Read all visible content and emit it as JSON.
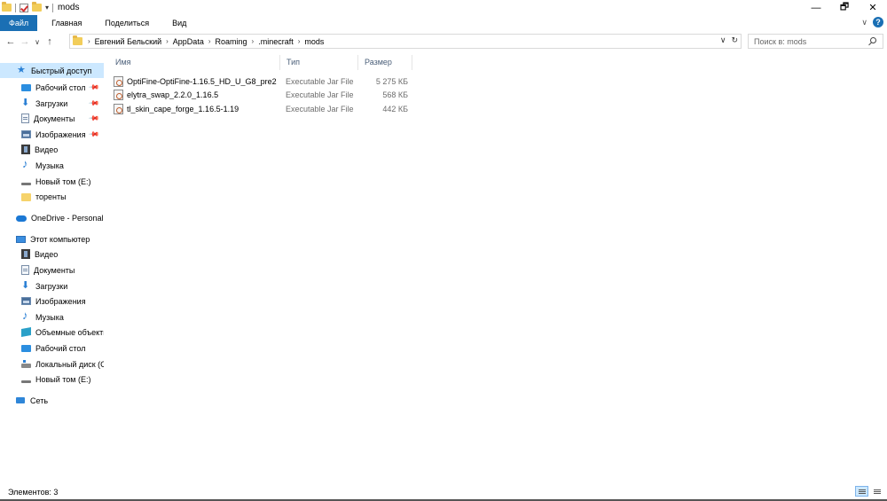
{
  "window": {
    "title": "mods",
    "controls": [
      "—",
      "🗗",
      "✕"
    ]
  },
  "ribbon": {
    "tabs": [
      "Файл",
      "Главная",
      "Поделиться",
      "Вид"
    ]
  },
  "address": {
    "crumbs": [
      "Евгений Бельский",
      "AppData",
      "Roaming",
      ".minecraft",
      "mods"
    ],
    "search_placeholder": "Поиск в: mods"
  },
  "sidebar": {
    "quick_access": "Быстрый доступ",
    "quick_items": [
      {
        "label": "Рабочий стол",
        "icon": "desktop-icon",
        "pinned": true
      },
      {
        "label": "Загрузки",
        "icon": "downloads-icon",
        "pinned": true
      },
      {
        "label": "Документы",
        "icon": "documents-icon",
        "pinned": true
      },
      {
        "label": "Изображения",
        "icon": "pictures-icon",
        "pinned": true
      },
      {
        "label": "Видео",
        "icon": "video-icon",
        "pinned": false
      },
      {
        "label": "Музыка",
        "icon": "music-icon",
        "pinned": false
      },
      {
        "label": "Новый том (E:)",
        "icon": "drive-icon",
        "pinned": false
      },
      {
        "label": "торенты",
        "icon": "folder-icon",
        "pinned": false
      }
    ],
    "onedrive": "OneDrive - Personal",
    "this_pc": "Этот компьютер",
    "pc_items": [
      {
        "label": "Видео",
        "icon": "video-icon"
      },
      {
        "label": "Документы",
        "icon": "documents-icon"
      },
      {
        "label": "Загрузки",
        "icon": "downloads-icon"
      },
      {
        "label": "Изображения",
        "icon": "pictures-icon"
      },
      {
        "label": "Музыка",
        "icon": "music-icon"
      },
      {
        "label": "Объемные объекты",
        "icon": "3d-objects-icon"
      },
      {
        "label": "Рабочий стол",
        "icon": "desktop-icon"
      },
      {
        "label": "Локальный диск (C:)",
        "icon": "local-disk-icon"
      },
      {
        "label": "Новый том (E:)",
        "icon": "drive-icon"
      }
    ],
    "network": "Сеть"
  },
  "columns": {
    "name": "Имя",
    "type": "Тип",
    "size": "Размер"
  },
  "files": [
    {
      "name": "OptiFine-OptiFine-1.16.5_HD_U_G8_pre2",
      "type": "Executable Jar File",
      "size": "5 275 КБ"
    },
    {
      "name": "elytra_swap_2.2.0_1.16.5",
      "type": "Executable Jar File",
      "size": "568 КБ"
    },
    {
      "name": "tl_skin_cape_forge_1.16.5-1.19",
      "type": "Executable Jar File",
      "size": "442 КБ"
    }
  ],
  "status": {
    "count_text": "Элементов: 3"
  }
}
